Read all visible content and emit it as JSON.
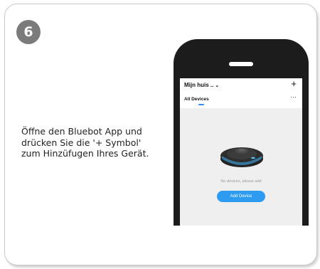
{
  "step": {
    "number": "6"
  },
  "instruction": {
    "line1": "Öffne den Bluebot App und",
    "line2": "drücken Sie die '+ Symbol'",
    "line3": "zum Hinzüfugen Ihres Gerät."
  },
  "app": {
    "home_title": "Mijn huis ..",
    "home_chevron": "⌄",
    "add_symbol": "+",
    "tab_label": "All Devices",
    "more_symbol": "···",
    "empty_message": "No devices, please add",
    "add_device_label": "Add Device"
  },
  "colors": {
    "accent": "#2d9cf0",
    "badge": "#7b7b7b",
    "phone_frame": "#1c1c1c"
  },
  "icons": [
    "plus-icon",
    "more-icon",
    "chevron-down-icon",
    "robot-vacuum-image"
  ]
}
